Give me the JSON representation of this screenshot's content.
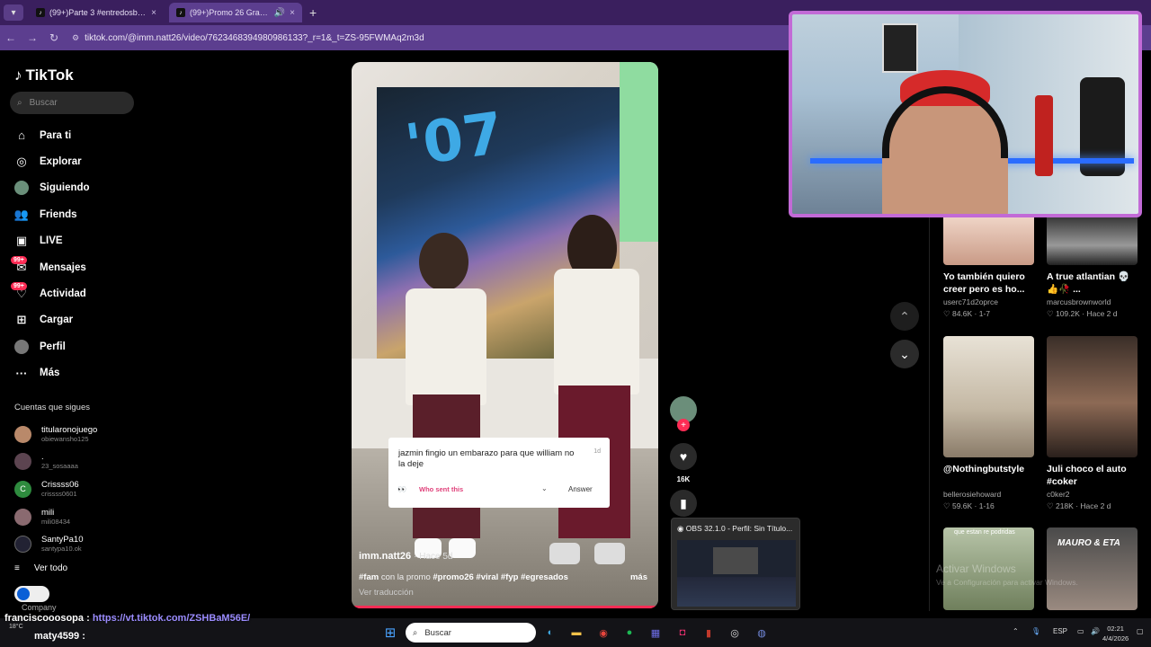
{
  "browser": {
    "tabs": [
      {
        "title": "(99+)Parte 3 #entredosbancos #...",
        "close": "×"
      },
      {
        "title": "(99+)Promo 26 Graduation",
        "close": "×",
        "sound": "🔊"
      }
    ],
    "new_tab": "+",
    "url": "tiktok.com/@imm.natt26/video/7623468394980986133?_r=1&_t=ZS-95FWMAq2m3d"
  },
  "sidebar": {
    "brand": "TikTok",
    "search_placeholder": "Buscar",
    "nav": [
      {
        "label": "Para ti",
        "icon": "home-icon"
      },
      {
        "label": "Explorar",
        "icon": "compass-icon"
      },
      {
        "label": "Siguiendo",
        "icon": "avatar-icon"
      },
      {
        "label": "Friends",
        "icon": "friends-icon"
      },
      {
        "label": "LIVE",
        "icon": "live-icon"
      },
      {
        "label": "Mensajes",
        "icon": "message-icon",
        "badge": "99+"
      },
      {
        "label": "Actividad",
        "icon": "bell-icon",
        "badge": "99+"
      },
      {
        "label": "Cargar",
        "icon": "upload-icon"
      },
      {
        "label": "Perfil",
        "icon": "profile-icon"
      },
      {
        "label": "Más",
        "icon": "more-icon"
      }
    ],
    "following_title": "Cuentas que sigues",
    "following": [
      {
        "name": "titularonojuego",
        "handle": "obiewansho125"
      },
      {
        "name": ".",
        "handle": "23_sosaaaa"
      },
      {
        "name": "Crissss06",
        "handle": "crissss0601"
      },
      {
        "name": "mili",
        "handle": "mili08434"
      },
      {
        "name": "SantyPa10",
        "handle": "santypa10.ok"
      }
    ],
    "see_all": "Ver todo",
    "company": "Company"
  },
  "video": {
    "username": "imm.natt26",
    "time_ago": "· Hace 5d",
    "description_prefix": "#fam",
    "description_mid": " con la promo ",
    "description_tags": "#promo26 #viral #fyp #egresados",
    "more": "más",
    "translate": "Ver traducción",
    "question_card": {
      "text": "jazmin fingio un embarazo para que william no la deje",
      "date": "1d",
      "eyes": "👀",
      "who": "Who sent this",
      "answer": "Answer"
    }
  },
  "actions": {
    "like_count": "16K",
    "plus": "+"
  },
  "recommendations": [
    {
      "title": "Yo también quiero creer pero es ho...",
      "user": "userc71d2oprce",
      "meta": "♡ 84.6K · 1-7"
    },
    {
      "title": "A true atlantian 💀👍🥀 ...",
      "user": "marcusbrownworld",
      "meta": "♡ 109.2K · Hace 2 d"
    },
    {
      "title": "@Nothingbutstyle",
      "user": "bellerosiehoward",
      "meta": "♡ 59.6K · 1-16"
    },
    {
      "title": "Juli choco el auto #coker",
      "user": "c0ker2",
      "meta": "♡ 218K · Hace 2 d"
    }
  ],
  "thumb_captions": {
    "left_bottom": "que estan re podridas",
    "right_bottom": "MAURO & ETA"
  },
  "obs": {
    "title": "OBS 32.1.0 - Perfil: Sin Título..."
  },
  "windows_watermark": {
    "line1": "Activar Windows",
    "line2": "Ve a Configuración para activar Windows."
  },
  "chat": [
    {
      "user": "franciscooosopa",
      "sep": " : ",
      "text": "https://vt.tiktok.com/ZSHBaM56E/"
    },
    {
      "user": "maty4599",
      "sep": " : ",
      "text": ""
    }
  ],
  "taskbar": {
    "weather_temp": "18°C",
    "search": "Buscar",
    "lang": "ESP",
    "time": "02:21",
    "date": "4/4/2026"
  },
  "colors": {
    "accent": "#fe2c55",
    "browser_frame": "#5c3e8f",
    "webcam_border": "#c26ad6"
  }
}
